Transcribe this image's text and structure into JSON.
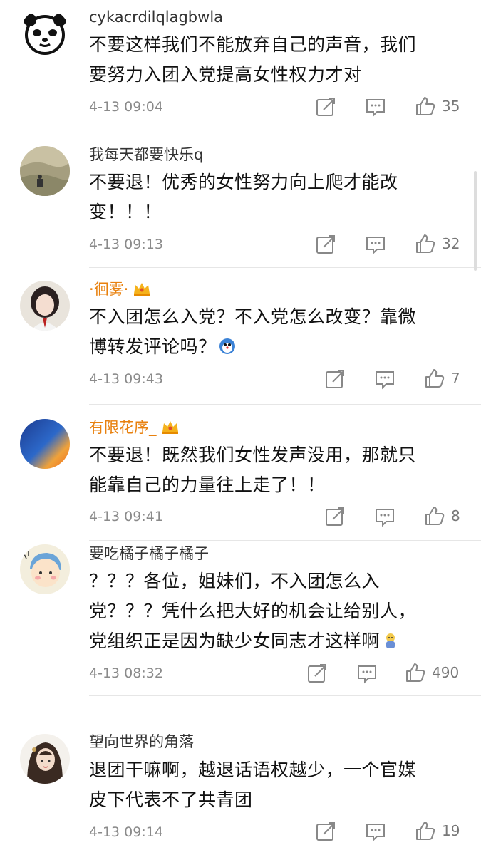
{
  "comments": [
    {
      "username": "cykacrdilqlagbwla",
      "avatar": "panda-face-avatar",
      "lines": [
        "不要这样我们不能放弃自己的声音，我们",
        "要努力入团入党提高女性权力才对"
      ],
      "time": "4-13 09:04",
      "likes": "35"
    },
    {
      "username": "我每天都要快乐q",
      "avatar": "landscape-photo-avatar",
      "lines": [
        "不要退！优秀的女性努力向上爬才能改",
        "变！！！"
      ],
      "time": "4-13 09:13",
      "likes": "32"
    },
    {
      "username": "·徊雾·",
      "avatar": "anime-girl-avatar",
      "lines": [
        "不入团怎么入党？不入党怎么改变？靠微",
        "博转发评论吗？"
      ],
      "time": "4-13 09:43",
      "likes": "7"
    },
    {
      "username": "有限花序_",
      "avatar": "gradient-orb-avatar",
      "lines": [
        "不要退！既然我们女性发声没用，那就只",
        "能靠自己的力量往上走了！！"
      ],
      "time": "4-13 09:41",
      "likes": "8"
    },
    {
      "username": "要吃橘子橘子橘子",
      "avatar": "cartoon-kid-avatar",
      "lines": [
        "？？？各位，姐妹们，不入团怎么入",
        "党？？？凭什么把大好的机会让给别人，",
        "党组织正是因为缺少女同志才这样啊"
      ],
      "time": "4-13 08:32",
      "likes": "490"
    },
    {
      "username": "望向世界的角落",
      "avatar": "illustrated-lady-avatar",
      "lines": [
        "退团干嘛啊，越退话语权越少，一个官媒",
        "皮下代表不了共青团"
      ],
      "time": "4-13 09:14",
      "likes": "19"
    }
  ],
  "colors": {
    "vip_name": "#e8810f",
    "text": "#111111",
    "meta": "#8a8a8a",
    "icon": "#888888"
  },
  "icons": [
    "share-icon",
    "comment-icon",
    "like-icon",
    "vip-crown-icon",
    "emoji-icon"
  ]
}
